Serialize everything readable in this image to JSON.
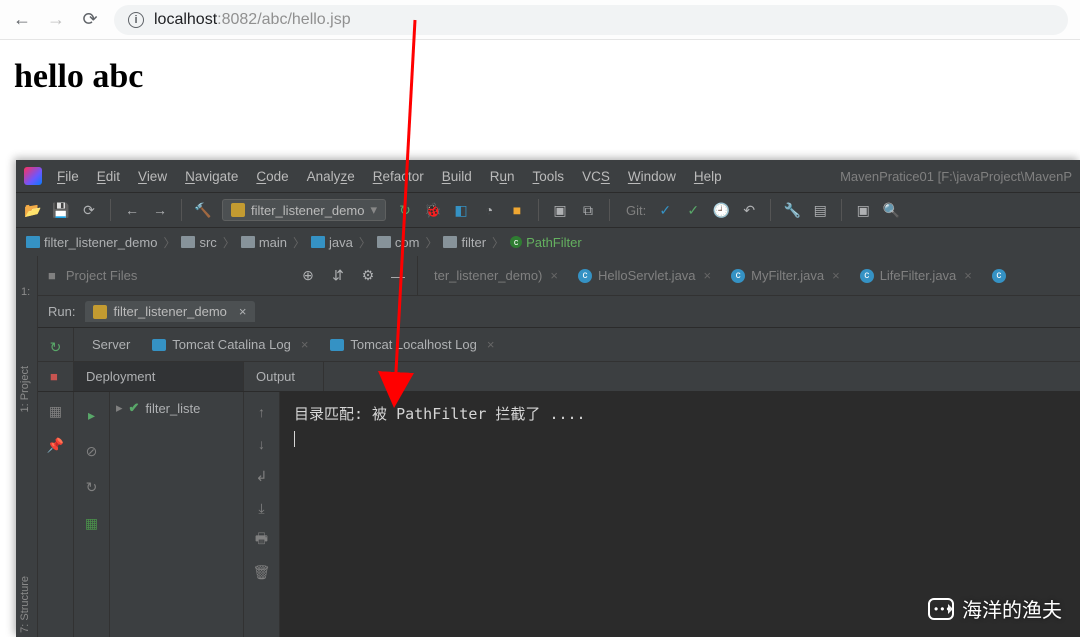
{
  "browser": {
    "url_host": "localhost",
    "url_port": ":8082",
    "url_path": "/abc/hello.jsp"
  },
  "page": {
    "heading": "hello abc"
  },
  "ide": {
    "menu": [
      "File",
      "Edit",
      "View",
      "Navigate",
      "Code",
      "Analyze",
      "Refactor",
      "Build",
      "Run",
      "Tools",
      "VCS",
      "Window",
      "Help"
    ],
    "title_path": "MavenPratice01 [F:\\javaProject\\MavenP",
    "run_config": "filter_listener_demo",
    "git_label": "Git:",
    "breadcrumbs": [
      {
        "icon": "folder-blue",
        "label": "filter_listener_demo"
      },
      {
        "icon": "folder",
        "label": "src"
      },
      {
        "icon": "folder",
        "label": "main"
      },
      {
        "icon": "folder-blue",
        "label": "java"
      },
      {
        "icon": "folder",
        "label": "com"
      },
      {
        "icon": "folder",
        "label": "filter"
      },
      {
        "icon": "class",
        "label": "PathFilter"
      }
    ],
    "project_panel_title": "Project Files",
    "editor_tabs": [
      {
        "label": "ter_listener_demo)"
      },
      {
        "label": "HelloServlet.java"
      },
      {
        "label": "MyFilter.java"
      },
      {
        "label": "LifeFilter.java"
      }
    ],
    "run_panel": {
      "title": "Run:",
      "config": "filter_listener_demo",
      "log_tabs": [
        {
          "label": "Server",
          "icon": false,
          "active": false
        },
        {
          "label": "Tomcat Catalina Log",
          "icon": true,
          "active": false
        },
        {
          "label": "Tomcat Localhost Log",
          "icon": true,
          "active": false
        }
      ],
      "deployment_label": "Deployment",
      "output_label": "Output",
      "deploy_item": "filter_liste",
      "console_line": "目录匹配: 被 PathFilter 拦截了 ...."
    },
    "side_tabs": {
      "project": "1: Project",
      "structure": "7: Structure"
    }
  },
  "watermark": "海洋的渔夫"
}
